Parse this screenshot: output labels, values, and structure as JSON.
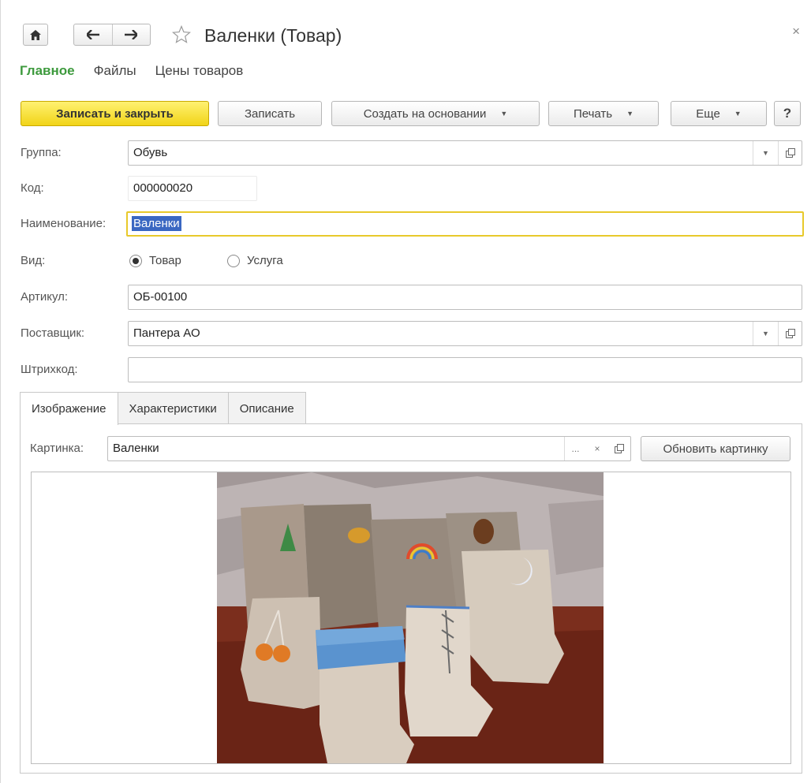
{
  "window": {
    "title": "Валенки (Товар)",
    "close_glyph": "×"
  },
  "nav": {
    "home_icon": "home-icon",
    "back_icon": "arrow-left-icon",
    "forward_icon": "arrow-right-icon",
    "favorite_icon": "star-icon"
  },
  "section_tabs": [
    {
      "label": "Главное",
      "active": true
    },
    {
      "label": "Файлы",
      "active": false
    },
    {
      "label": "Цены товаров",
      "active": false
    }
  ],
  "toolbar": {
    "save_close": "Записать и закрыть",
    "save": "Записать",
    "create_based": "Создать на основании",
    "print": "Печать",
    "more": "Еще",
    "help": "?"
  },
  "form": {
    "group_label": "Группа:",
    "group_value": "Обувь",
    "code_label": "Код:",
    "code_value": "000000020",
    "name_label": "Наименование:",
    "name_value": "Валенки",
    "kind_label": "Вид:",
    "kind_options": [
      {
        "label": "Товар",
        "selected": true
      },
      {
        "label": "Услуга",
        "selected": false
      }
    ],
    "article_label": "Артикул:",
    "article_value": "ОБ-00100",
    "supplier_label": "Поставщик:",
    "supplier_value": "Пантера АО",
    "barcode_label": "Штрихкод:",
    "barcode_value": ""
  },
  "detail_tabs": [
    {
      "label": "Изображение",
      "active": true
    },
    {
      "label": "Характеристики",
      "active": false
    },
    {
      "label": "Описание",
      "active": false
    }
  ],
  "picture": {
    "label": "Картинка:",
    "value": "Валенки",
    "choose_glyph": "...",
    "clear_glyph": "×",
    "refresh_button": "Обновить картинку"
  },
  "colors": {
    "accent_green": "#3d9a3d",
    "primary_button_yellow": "#f1d418",
    "focus_border": "#e8c92b",
    "selection_blue": "#3a67c2"
  }
}
